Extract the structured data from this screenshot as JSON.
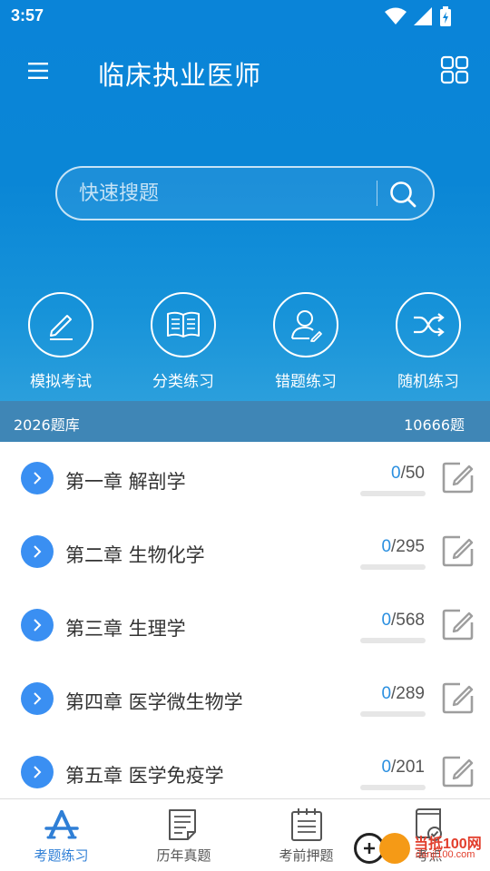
{
  "status": {
    "time": "3:57"
  },
  "header": {
    "title": "临床执业医师"
  },
  "search": {
    "placeholder": "快速搜题"
  },
  "quick_actions": [
    {
      "label": "模拟考试",
      "icon": "pencil-icon"
    },
    {
      "label": "分类练习",
      "icon": "book-icon"
    },
    {
      "label": "错题练习",
      "icon": "user-edit-icon"
    },
    {
      "label": "随机练习",
      "icon": "shuffle-icon"
    }
  ],
  "bank": {
    "name": "2026题库",
    "count": "10666题"
  },
  "chapters": [
    {
      "title": "第一章 解剖学",
      "done": "0",
      "total": "/50",
      "progress": 0
    },
    {
      "title": "第二章 生物化学",
      "done": "0",
      "total": "/295",
      "progress": 0
    },
    {
      "title": "第三章 生理学",
      "done": "0",
      "total": "/568",
      "progress": 0
    },
    {
      "title": "第四章 医学微生物学",
      "done": "0",
      "total": "/289",
      "progress": 0
    },
    {
      "title": "第五章 医学免疫学",
      "done": "0",
      "total": "/201",
      "progress": 0
    }
  ],
  "tabs": [
    {
      "label": "考题练习",
      "icon": "practice-icon",
      "active": true
    },
    {
      "label": "历年真题",
      "icon": "paper-icon",
      "active": false
    },
    {
      "label": "考前押题",
      "icon": "notepad-icon",
      "active": false
    },
    {
      "label": "考点",
      "icon": "book-check-icon",
      "active": false
    }
  ],
  "watermark": {
    "brand": "当抵100网",
    "site": "danji100.com"
  },
  "colors": {
    "primary": "#0a84d8",
    "accent": "#2a8fe0",
    "bank_bar": "#3f86b6",
    "active_tab": "#2f7fd6"
  }
}
